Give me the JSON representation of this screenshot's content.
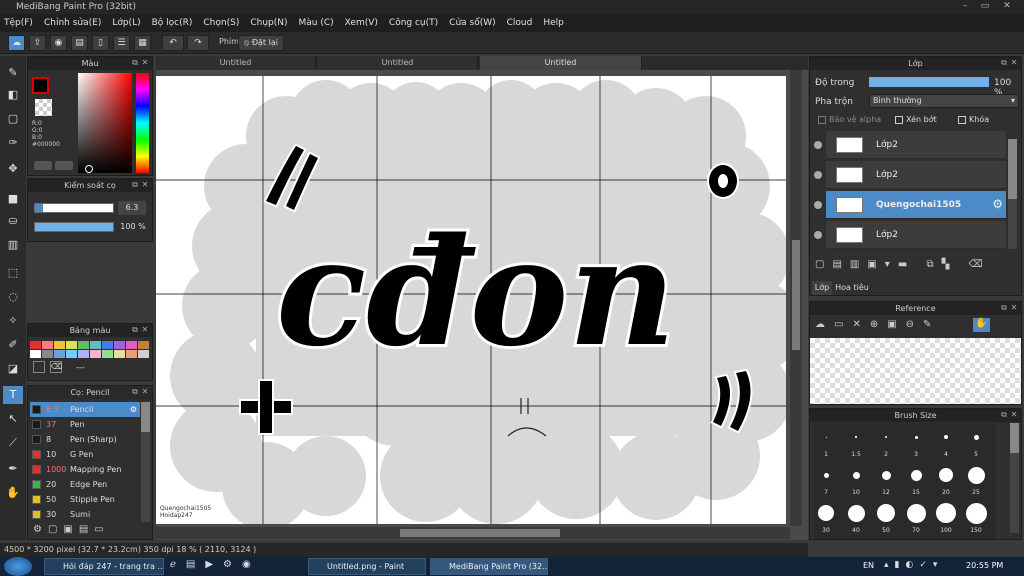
{
  "window": {
    "title": "MediBang Paint Pro (32bit)"
  },
  "menu": [
    "Tệp(F)",
    "Chỉnh sửa(E)",
    "Lớp(L)",
    "Bộ lọc(R)",
    "Chọn(S)",
    "Chụp(N)",
    "Màu (C)",
    "Xem(V)",
    "Công cụ(T)",
    "Cửa sổ(W)",
    "Cloud",
    "Help"
  ],
  "toolbar": {
    "phim_label": "Phím",
    "reset_label": "Đặt lại"
  },
  "tabs": [
    "Untitled",
    "Untitled",
    "Untitled"
  ],
  "color_panel": {
    "title": "Màu",
    "r": "R:0",
    "g": "G:0",
    "b": "B:0",
    "hex": "#000000"
  },
  "brush_control": {
    "title": "Kiểm soát cọ",
    "size": "6.3",
    "opacity": "100 %",
    "opacity_value": 1.0
  },
  "palette": {
    "title": "Bảng màu",
    "extra": "---"
  },
  "brush_list": {
    "title": "Cọ: Pencil",
    "items": [
      {
        "size": "6.3",
        "name": "Pencil",
        "color": "#1a1a1a",
        "selected": true
      },
      {
        "size": "37",
        "name": "Pen",
        "color": "#1a1a1a"
      },
      {
        "size": "8",
        "name": "Pen (Sharp)",
        "color": "#1a1a1a"
      },
      {
        "size": "10",
        "name": "G Pen",
        "color": "#e03030"
      },
      {
        "size": "1000",
        "name": "Mapping Pen",
        "color": "#e03030"
      },
      {
        "size": "20",
        "name": "Edge Pen",
        "color": "#3cb44b"
      },
      {
        "size": "50",
        "name": "Stipple Pen",
        "color": "#e0c020"
      },
      {
        "size": "30",
        "name": "Sumi",
        "color": "#e0c020"
      }
    ]
  },
  "canvas": {
    "signature_line1": "Quengochai1505",
    "signature_line2": "Hoidap247",
    "lettering": "cđon"
  },
  "layers_panel": {
    "title": "Lớp",
    "opacity_label": "Độ trong",
    "opacity_value": "100 %",
    "opacity_fill": 1.0,
    "blend_label": "Pha trộn",
    "blend_value": "Bình thường",
    "protect_alpha": "Bảo vệ alpha",
    "clipping": "Xén bớt",
    "lock": "Khóa",
    "layers": [
      {
        "name": "Lớp2",
        "selected": false
      },
      {
        "name": "Lớp2",
        "selected": false
      },
      {
        "name": "Quengochai1505",
        "selected": true
      },
      {
        "name": "Lớp2",
        "selected": false
      }
    ],
    "bottom_tabs": [
      "Lớp",
      "Hoa tiêu"
    ]
  },
  "reference_panel": {
    "title": "Reference"
  },
  "brush_size_panel": {
    "title": "Brush Size",
    "labels_row1": [
      ".",
      "1.5",
      ".",
      ".",
      ".",
      "."
    ],
    "labels_row1b": [
      "1",
      "1.5",
      "2",
      "3",
      "4",
      "5"
    ],
    "labels_row2": [
      "7",
      "10",
      "12",
      "15",
      "20",
      "25"
    ],
    "labels_row3": [
      "30",
      "40",
      "50",
      "70",
      "100",
      "150"
    ]
  },
  "status": {
    "text": "4500 * 3200 pixel  (32.7 * 23.2cm)  350 dpi  18 %  ( 2110, 3124 )"
  },
  "taskbar": {
    "tasks": [
      "Hỏi đáp 247 - trang tra ...",
      "Untitled.png - Paint",
      "MediBang Paint Pro (32..."
    ],
    "lang": "EN",
    "time": "20:55 PM"
  }
}
